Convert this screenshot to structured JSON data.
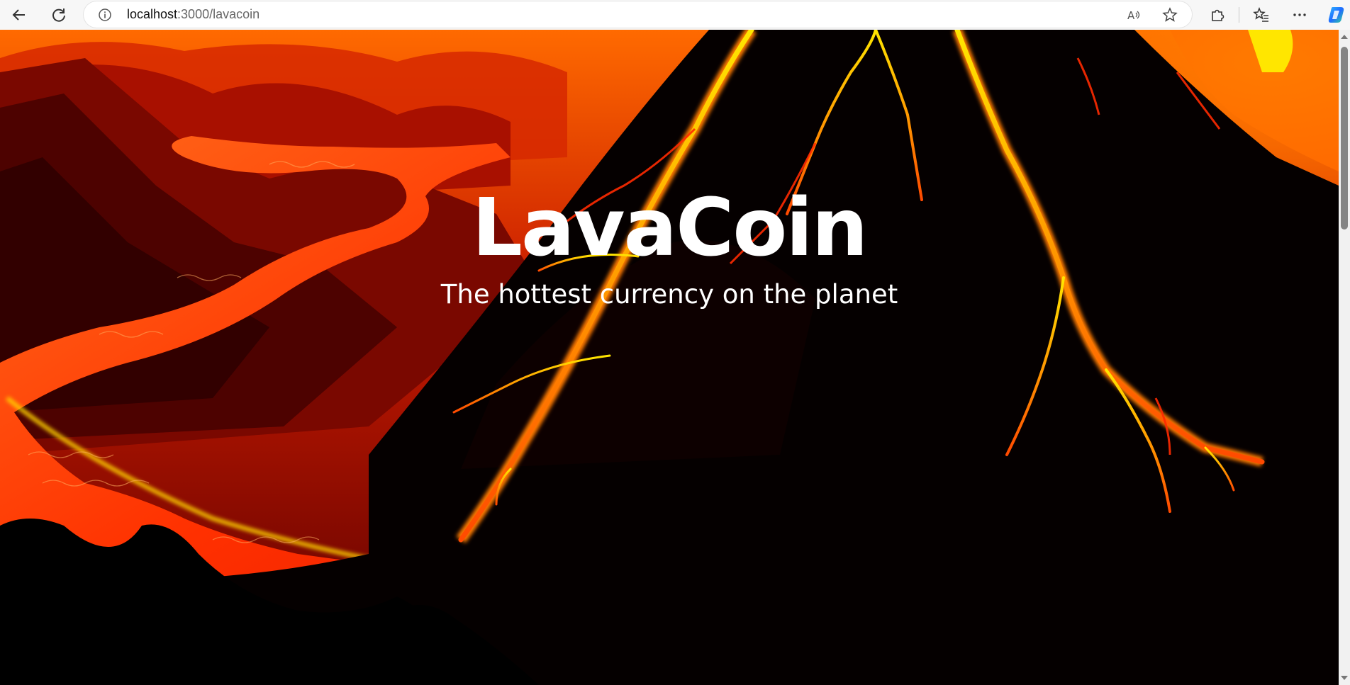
{
  "browser": {
    "url_host": "localhost",
    "url_path": ":3000/lavacoin"
  },
  "hero": {
    "title": "LavaCoin",
    "subtitle": "The hottest currency on the planet"
  },
  "colors": {
    "lava_bright": "#ff3b00",
    "lava_glow": "#ffb300",
    "rock_dark": "#2a0000",
    "sky": "#c81a00"
  }
}
